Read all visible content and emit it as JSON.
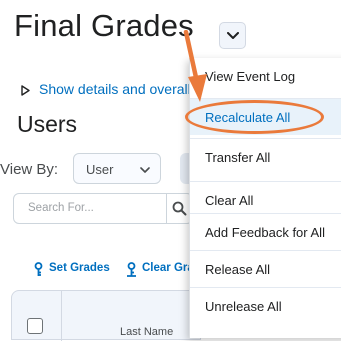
{
  "page": {
    "title": "Final Grades",
    "details_link": "Show details and overall",
    "section_title": "Users",
    "view_by_label": "View By:",
    "view_by_value": "User",
    "search_placeholder": "Search For...",
    "set_grades": "Set Grades",
    "clear_grades": "Clear Gra",
    "last_name_header": "Last Name"
  },
  "menu": {
    "items": [
      {
        "label": "View Event Log"
      },
      {
        "label": "Recalculate All",
        "highlighted": true
      },
      {
        "label": "Transfer All"
      },
      {
        "label": "Clear All"
      },
      {
        "label": "Add Feedback for All"
      },
      {
        "label": "Release All"
      },
      {
        "label": "Unrelease All"
      }
    ]
  },
  "icons": {
    "title_menu": "chevron-down-icon",
    "details": "triangle-right-icon",
    "search": "search-icon",
    "set_grades": "key-icon",
    "clear_grades": "key-icon"
  },
  "colors": {
    "link": "#006fbf",
    "annotation": "#ea7a3b",
    "menu_highlight": "#e8f2fa"
  }
}
